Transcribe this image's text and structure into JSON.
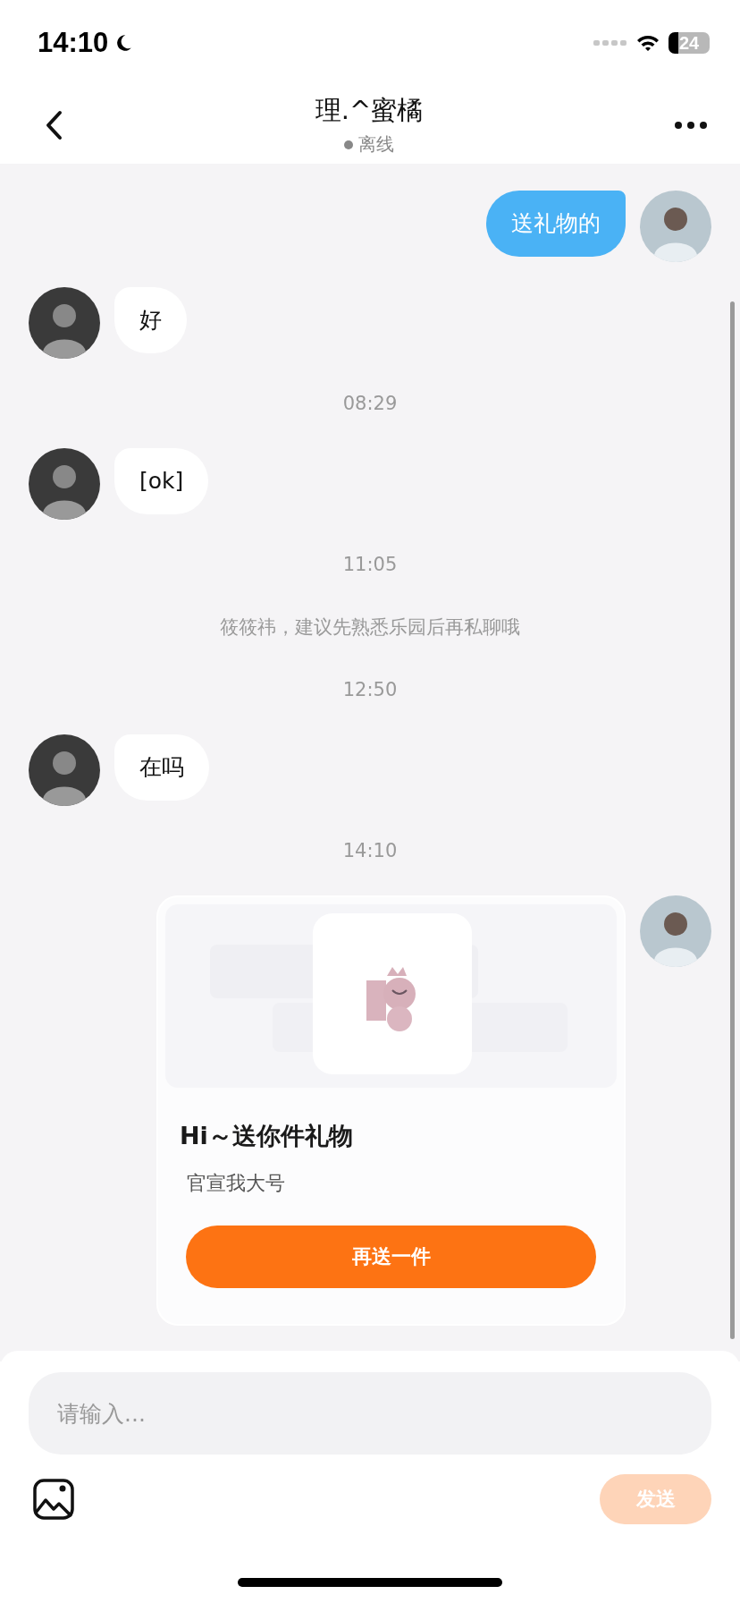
{
  "status_bar": {
    "time": "14:10",
    "battery": "24"
  },
  "header": {
    "title": "理.^蜜橘",
    "status": "离线",
    "online": false
  },
  "messages": [
    {
      "kind": "text",
      "outgoing": true,
      "text": "送礼物的"
    },
    {
      "kind": "text",
      "outgoing": false,
      "text": "好"
    },
    {
      "kind": "time",
      "text": "08:29"
    },
    {
      "kind": "text",
      "outgoing": false,
      "text": "[ok]"
    },
    {
      "kind": "time",
      "text": "11:05"
    },
    {
      "kind": "notice",
      "text": "筱筱祎，建议先熟悉乐园后再私聊哦"
    },
    {
      "kind": "time",
      "text": "12:50"
    },
    {
      "kind": "text",
      "outgoing": false,
      "text": "在吗"
    },
    {
      "kind": "time",
      "text": "14:10"
    },
    {
      "kind": "gift",
      "title": "Hi～送你件礼物",
      "subtitle": "官宣我大号",
      "button": "再送一件"
    }
  ],
  "composer": {
    "placeholder": "请输入...",
    "send": "发送",
    "send_enabled": false
  }
}
